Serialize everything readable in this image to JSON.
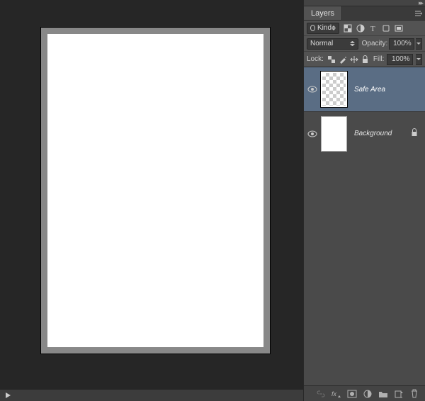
{
  "panel": {
    "title": "Layers",
    "filter_label": "Kind",
    "blend_mode": "Normal",
    "opacity_label": "Opacity:",
    "opacity_value": "100%",
    "lock_label": "Lock:",
    "fill_label": "Fill:",
    "fill_value": "100%"
  },
  "layers": [
    {
      "name": "Safe Area",
      "locked": false,
      "visible": true
    },
    {
      "name": "Background",
      "locked": true,
      "visible": true
    }
  ]
}
